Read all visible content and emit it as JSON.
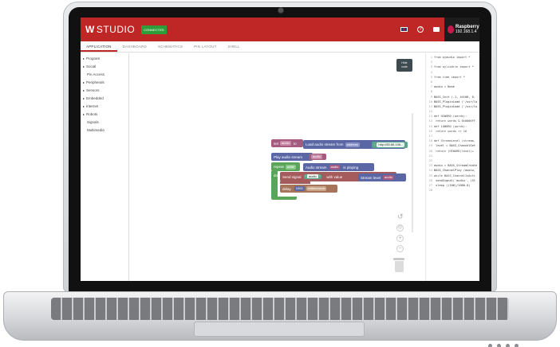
{
  "app": {
    "logo_mark": "W",
    "logo_text": "STUDIO",
    "status": "CONNECTED",
    "device_name": "Raspberry",
    "device_sub": "192.168.1.4"
  },
  "tabs": [
    "APPLICATION",
    "DASHBOARD",
    "SCHEMATICS",
    "PIN LAYOUT",
    "SHELL"
  ],
  "sidebar": [
    {
      "label": "Program",
      "arrow": true
    },
    {
      "label": "Social",
      "arrow": true
    },
    {
      "label": "Pin Access",
      "arrow": false
    },
    {
      "label": "Peripherals",
      "arrow": true
    },
    {
      "label": "Sensors",
      "arrow": true
    },
    {
      "label": "Embedded",
      "arrow": true
    },
    {
      "label": "Internet",
      "arrow": true
    },
    {
      "label": "Robots",
      "arrow": true
    },
    {
      "label": "Signals",
      "arrow": false
    },
    {
      "label": "Multimedia",
      "arrow": false
    }
  ],
  "hide_code": {
    "line1": "Hide",
    "line2": "code"
  },
  "blocks": {
    "set": "set",
    "audio_var": "audio",
    "to": "to",
    "load_audio": "Load audio  stream from",
    "address": "address",
    "url": "http://80.86.106...",
    "play_audio": "Play audio stream",
    "repeat": "repeat",
    "while": "while",
    "audio_stream": "Audio stream",
    "is_playing": "is playing",
    "do": "do",
    "send_signal": "Send signal",
    "signal_name": "audio",
    "with_value": "with value",
    "stream_level": "Stream level",
    "delay": "delay",
    "delay_value": "1000",
    "milliseconds": "milliseconds"
  },
  "code_lines": [
    {
      "n": "1",
      "t": "from pyaudio import *"
    },
    {
      "n": "2",
      "t": ""
    },
    {
      "n": "3",
      "t": "from wyliodrin import *"
    },
    {
      "n": "4",
      "t": ""
    },
    {
      "n": "5",
      "t": "from time import *"
    },
    {
      "n": "6",
      "t": ""
    },
    {
      "n": "7",
      "t": "audio = None"
    },
    {
      "n": "8",
      "t": ""
    },
    {
      "n": "9",
      "t": "BASS_Init (-1, 44100, 0,"
    },
    {
      "n": "10",
      "t": "BASS_PluginLoad ('/usr/lo"
    },
    {
      "n": "11",
      "t": "BASS_PluginLoad ('/usr/lo"
    },
    {
      "n": "12",
      "t": ""
    },
    {
      "n": "13",
      "t": "def HIWORD (words):"
    },
    {
      "n": "14",
      "t": "  return words & 0x0000FF"
    },
    {
      "n": "15",
      "t": "def LOWORD (words):"
    },
    {
      "n": "16",
      "t": "  return words >> 16"
    },
    {
      "n": "17",
      "t": ""
    },
    {
      "n": "18",
      "t": "def StreamLevel (stream,"
    },
    {
      "n": "19",
      "t": "  level = BASS_ChannelGet"
    },
    {
      "n": "20",
      "t": "  return (HIWORD(level)+"
    },
    {
      "n": "21",
      "t": ""
    },
    {
      "n": "22",
      "t": ""
    },
    {
      "n": "23",
      "t": "audio = BASS_StreamCreate"
    },
    {
      "n": "24",
      "t": "BASS_ChannelPlay (audio,"
    },
    {
      "n": "25",
      "t": "while BASS_ChannelIsActi"
    },
    {
      "n": "26",
      "t": "  sendSignal('audio', (St"
    },
    {
      "n": "27",
      "t": "  sleep ((100)/1000.0)"
    },
    {
      "n": "28",
      "t": ""
    }
  ],
  "colors": {
    "brand_red": "#bf2626",
    "connected_green": "#2e9e3a",
    "variables": "#a55b80",
    "audio_block": "#5b67a5",
    "text_value": "#5ba58c",
    "loop_green": "#5ba55b",
    "signals": "#a55b5b",
    "delay": "#a5745b"
  }
}
